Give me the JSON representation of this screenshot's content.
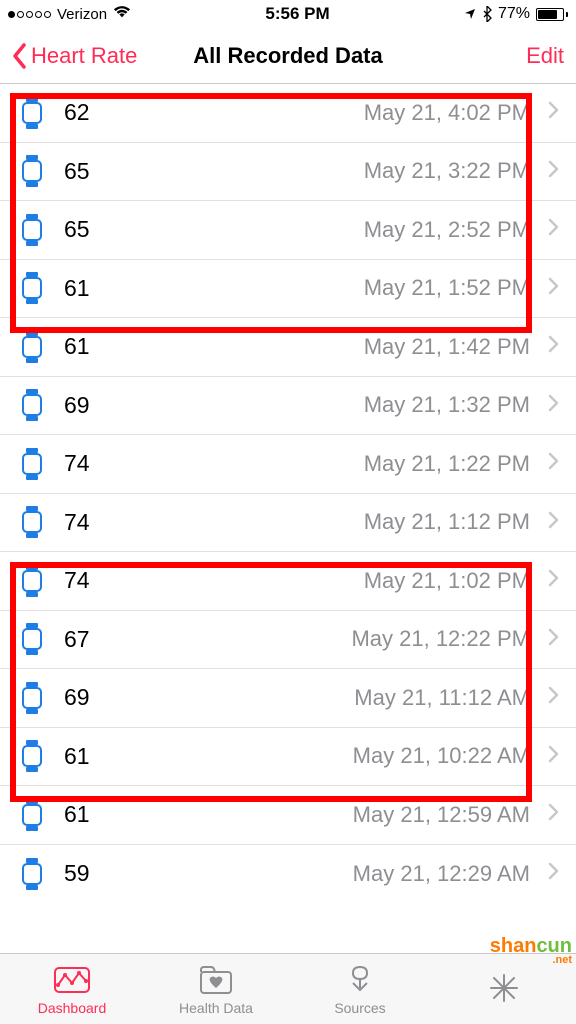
{
  "status": {
    "signal_filled": 1,
    "signal_total": 5,
    "carrier": "Verizon",
    "time": "5:56 PM",
    "battery_pct": "77%",
    "battery_fill_pct": 77
  },
  "nav": {
    "back_label": "Heart Rate",
    "title": "All Recorded Data",
    "edit_label": "Edit"
  },
  "rows": [
    {
      "value": "62",
      "time": "May 21, 4:02 PM"
    },
    {
      "value": "65",
      "time": "May 21, 3:22 PM"
    },
    {
      "value": "65",
      "time": "May 21, 2:52 PM"
    },
    {
      "value": "61",
      "time": "May 21, 1:52 PM"
    },
    {
      "value": "61",
      "time": "May 21, 1:42 PM"
    },
    {
      "value": "69",
      "time": "May 21, 1:32 PM"
    },
    {
      "value": "74",
      "time": "May 21, 1:22 PM"
    },
    {
      "value": "74",
      "time": "May 21, 1:12 PM"
    },
    {
      "value": "74",
      "time": "May 21, 1:02 PM"
    },
    {
      "value": "67",
      "time": "May 21, 12:22 PM"
    },
    {
      "value": "69",
      "time": "May 21, 11:12 AM"
    },
    {
      "value": "61",
      "time": "May 21, 10:22 AM"
    },
    {
      "value": "61",
      "time": "May 21, 12:59 AM"
    },
    {
      "value": "59",
      "time": "May 21, 12:29 AM"
    }
  ],
  "tabs": [
    {
      "label": "Dashboard",
      "icon": "dashboard",
      "active": true
    },
    {
      "label": "Health Data",
      "icon": "health-data",
      "active": false
    },
    {
      "label": "Sources",
      "icon": "sources",
      "active": false
    },
    {
      "label": "",
      "icon": "medical-id",
      "active": false
    }
  ],
  "watermark": {
    "main1": "shan",
    "main2": "cun",
    "sub": ".net"
  }
}
